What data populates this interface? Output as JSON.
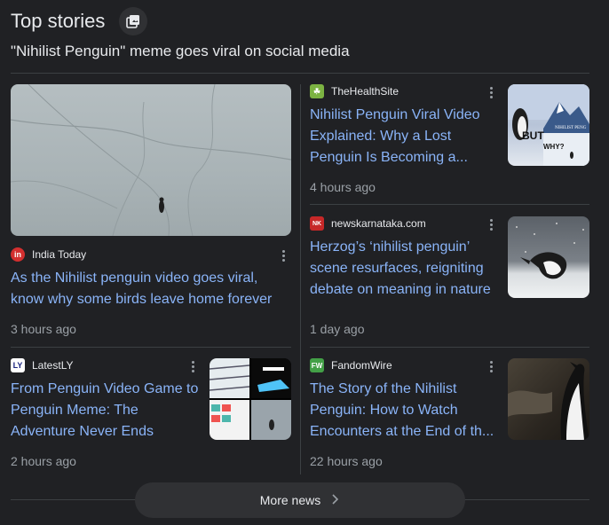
{
  "header": {
    "title": "Top stories",
    "subtitle": "\"Nihilist Penguin\" meme goes viral on social media"
  },
  "featured": {
    "source": "India Today",
    "favicon_text": "in",
    "favicon_color": "#d32f2f",
    "headline": "As the Nihilist penguin video goes viral, know why some birds leave home forever",
    "time": "3 hours ago"
  },
  "stories": [
    {
      "source": "TheHealthSite",
      "favicon_text": "☘",
      "favicon_color": "#7cb342",
      "headline_lines": [
        "Nihilist Penguin Viral Video",
        "Explained: Why a Lost",
        "Penguin Is Becoming a..."
      ],
      "time": "4 hours ago",
      "thumb_text_1": "BUT",
      "thumb_text_2": "WHY?",
      "thumb_text_3": "NIHILIST PENG"
    },
    {
      "source": "newskarnataka.com",
      "favicon_text": "NK",
      "favicon_color": "#c62828",
      "headline_lines": [
        "Herzog’s ‘nihilist penguin’",
        "scene resurfaces, reigniting",
        "debate on meaning in nature"
      ],
      "time": "1 day ago"
    },
    {
      "source": "LatestLY",
      "favicon_text": "LY",
      "favicon_color": "#ffffff",
      "headline_lines": [
        "From Penguin Video Game to",
        "Penguin Meme: The",
        "Adventure Never Ends"
      ],
      "time": "2 hours ago"
    },
    {
      "source": "FandomWire",
      "favicon_text": "FW",
      "favicon_color": "#43a047",
      "headline_lines": [
        "The Story of the Nihilist",
        "Penguin: How to Watch",
        "Encounters at the End of th..."
      ],
      "time": "22 hours ago"
    }
  ],
  "more_news": {
    "label": "More news"
  },
  "icons": {
    "header": "image-stack-icon",
    "more": "chevron-right-icon",
    "menu": "more-vert-icon"
  }
}
